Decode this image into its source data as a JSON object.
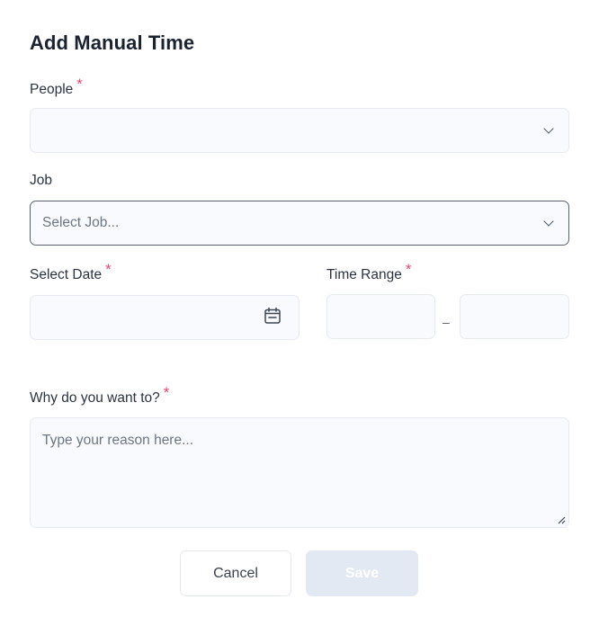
{
  "modal": {
    "title": "Add Manual Time"
  },
  "people": {
    "label": "People",
    "required_mark": "*",
    "value": ""
  },
  "job": {
    "label": "Job",
    "placeholder": "Select Job..."
  },
  "date": {
    "label": "Select Date",
    "required_mark": "*",
    "value": ""
  },
  "time_range": {
    "label": "Time Range",
    "required_mark": "*",
    "separator": "–",
    "start": "",
    "end": ""
  },
  "reason": {
    "label": "Why do you want to?",
    "required_mark": "*",
    "placeholder": "Type your reason here..."
  },
  "actions": {
    "cancel_label": "Cancel",
    "save_label": "Save"
  },
  "colors": {
    "required": "#e5486b",
    "save_disabled_bg": "#e3e9f3",
    "field_bg": "#f8fafd"
  },
  "icons": {
    "dropdown": "chevron-down-icon",
    "date": "calendar-icon"
  }
}
